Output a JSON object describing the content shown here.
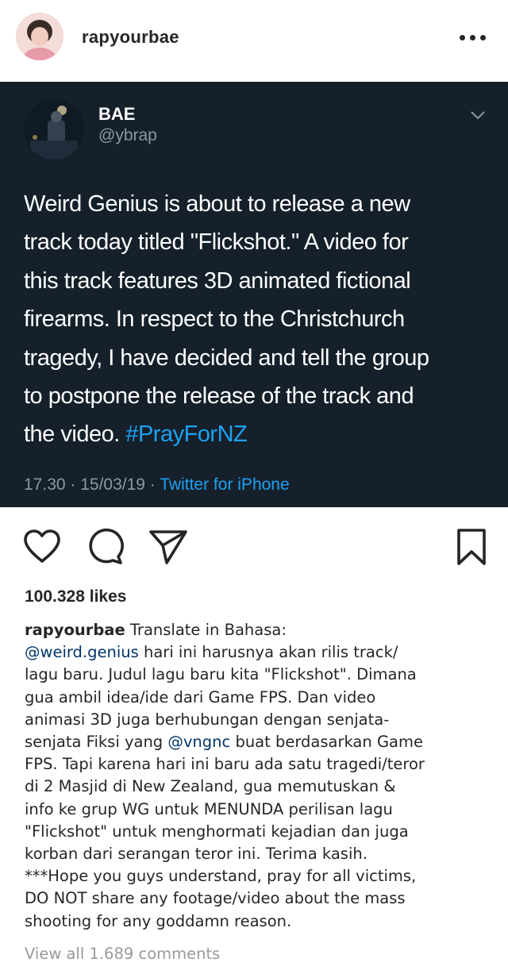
{
  "post": {
    "username": "rapyourbae",
    "likes": "100.328 likes",
    "view_comments": "View all 1.689 comments"
  },
  "tweet": {
    "name": "BAE",
    "handle": "@ybrap",
    "lines": [
      "Weird Genius is about to release a new",
      "track today titled \"Flickshot.\" A video for",
      "this track features 3D animated fictional",
      "firearms. In respect to the Christchurch",
      "tragedy, I have decided and tell the group",
      "to postpone the release of the track and"
    ],
    "last_line": "the video.",
    "hashtag": "#PrayForNZ",
    "time": "17.30 · 15/03/19 · ",
    "source": "Twitter for iPhone"
  },
  "caption": {
    "author": "rapyourbae",
    "intro": " Translate in Bahasa:",
    "mention1": "@weird.genius",
    "line2_rest": " hari ini harusnya akan rilis track/",
    "line3": "lagu baru. Judul lagu baru kita \"Flickshot\". Dimana",
    "line4": "gua ambil idea/ide dari Game FPS. Dan video",
    "line5": "animasi 3D juga berhubungan dengan senjata-",
    "line6_pre": "senjata Fiksi yang ",
    "mention2": "@vngnc",
    "line6_post": " buat berdasarkan Game",
    "line7": "FPS. Tapi karena hari ini baru ada satu tragedi/teror",
    "line8": "di 2 Masjid di New Zealand, gua memutuskan &",
    "line9": "info ke grup WG untuk MENUNDA perilisan lagu",
    "line10": "\"Flickshot\" untuk menghormati kejadian dan juga",
    "line11": "korban dari serangan teror ini. Terima kasih.",
    "line12": "***Hope you guys understand, pray for all victims,",
    "line13": "DO NOT share any footage/video about the mass",
    "line14": "shooting for any goddamn reason."
  },
  "icons": {
    "like": "heart-icon",
    "comment": "comment-icon",
    "share": "send-icon",
    "save": "bookmark-icon",
    "more": "more-icon",
    "tweet_menu": "chevron-down-icon"
  },
  "colors": {
    "tweet_bg": "#15202b",
    "twitter_blue": "#1da1f2",
    "mention": "#003569",
    "muted": "#999999"
  }
}
